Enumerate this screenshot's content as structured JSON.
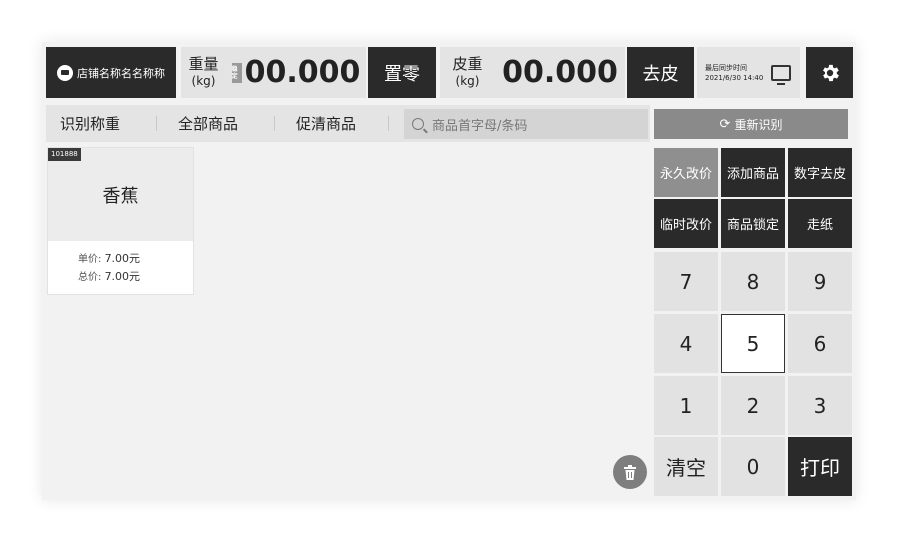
{
  "header": {
    "shop_name": "店铺名称名名称称",
    "weight_label": "重量",
    "weight_unit": "(kg)",
    "stable_tag": "稳定",
    "weight_value": "00.000",
    "zero_button": "置零",
    "tare_label": "皮重",
    "tare_unit": "(kg)",
    "tare_value": "00.000",
    "tare_button": "去皮",
    "sync_title": "最后同步时间",
    "sync_time": "2021/6/30 14:40"
  },
  "tabs": [
    "识别称重",
    "全部商品",
    "促清商品"
  ],
  "search": {
    "placeholder": "商品首字母/条码"
  },
  "recognize_button": "重新识别",
  "products": [
    {
      "code": "101888",
      "name": "香蕉",
      "unit_price_label": "单价:",
      "unit_price": "7.00元",
      "total_price_label": "总价:",
      "total_price": "7.00元"
    }
  ],
  "functions": {
    "permanent_price": "永久改价",
    "add_product": "添加商品",
    "digital_tare": "数字去皮",
    "temp_price": "临时改价",
    "lock_product": "商品锁定",
    "feed_paper": "走纸"
  },
  "keypad": {
    "k7": "7",
    "k8": "8",
    "k9": "9",
    "k4": "4",
    "k5": "5",
    "k6": "6",
    "k1": "1",
    "k2": "2",
    "k3": "3",
    "clear": "清空",
    "k0": "0",
    "print": "打印"
  }
}
